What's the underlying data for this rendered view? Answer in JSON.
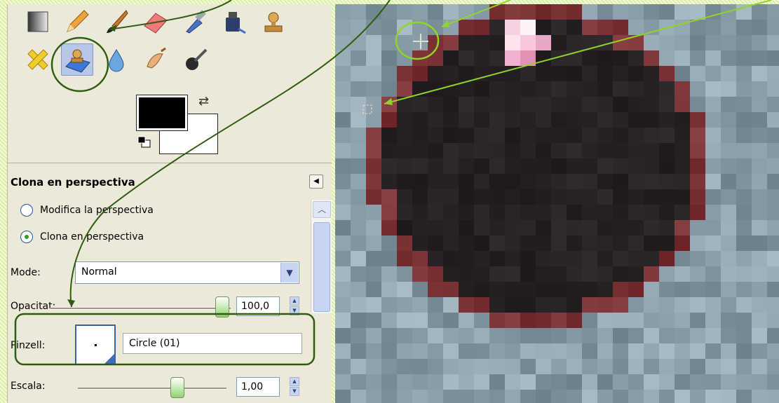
{
  "tool_options": {
    "title": "Clona en perspectiva",
    "radio_modify": "Modifica la perspectiva",
    "radio_clone": "Clona en perspectiva",
    "mode_label": "Mode:",
    "mode_value": "Normal",
    "opacity_label": "Opacitat:",
    "opacity_value": "100,0",
    "brush_label": "Pinzell:",
    "brush_value": "Circle (01)",
    "scale_label": "Escala:",
    "scale_value": "1,00"
  },
  "tools": [
    "blend-tool-icon",
    "pencil-tool-icon",
    "paintbrush-tool-icon",
    "eraser-tool-icon",
    "airbrush-tool-icon",
    "ink-tool-icon",
    "clone-tool-icon",
    "heal-tool-icon",
    "perspective-clone-tool-icon",
    "blur-sharpen-tool-icon",
    "smudge-tool-icon",
    "dodge-burn-tool-icon"
  ],
  "colors": {
    "foreground": "#000000",
    "background": "#ffffff",
    "annotation": "#2e5d12",
    "highlight": "#8fd42a"
  }
}
